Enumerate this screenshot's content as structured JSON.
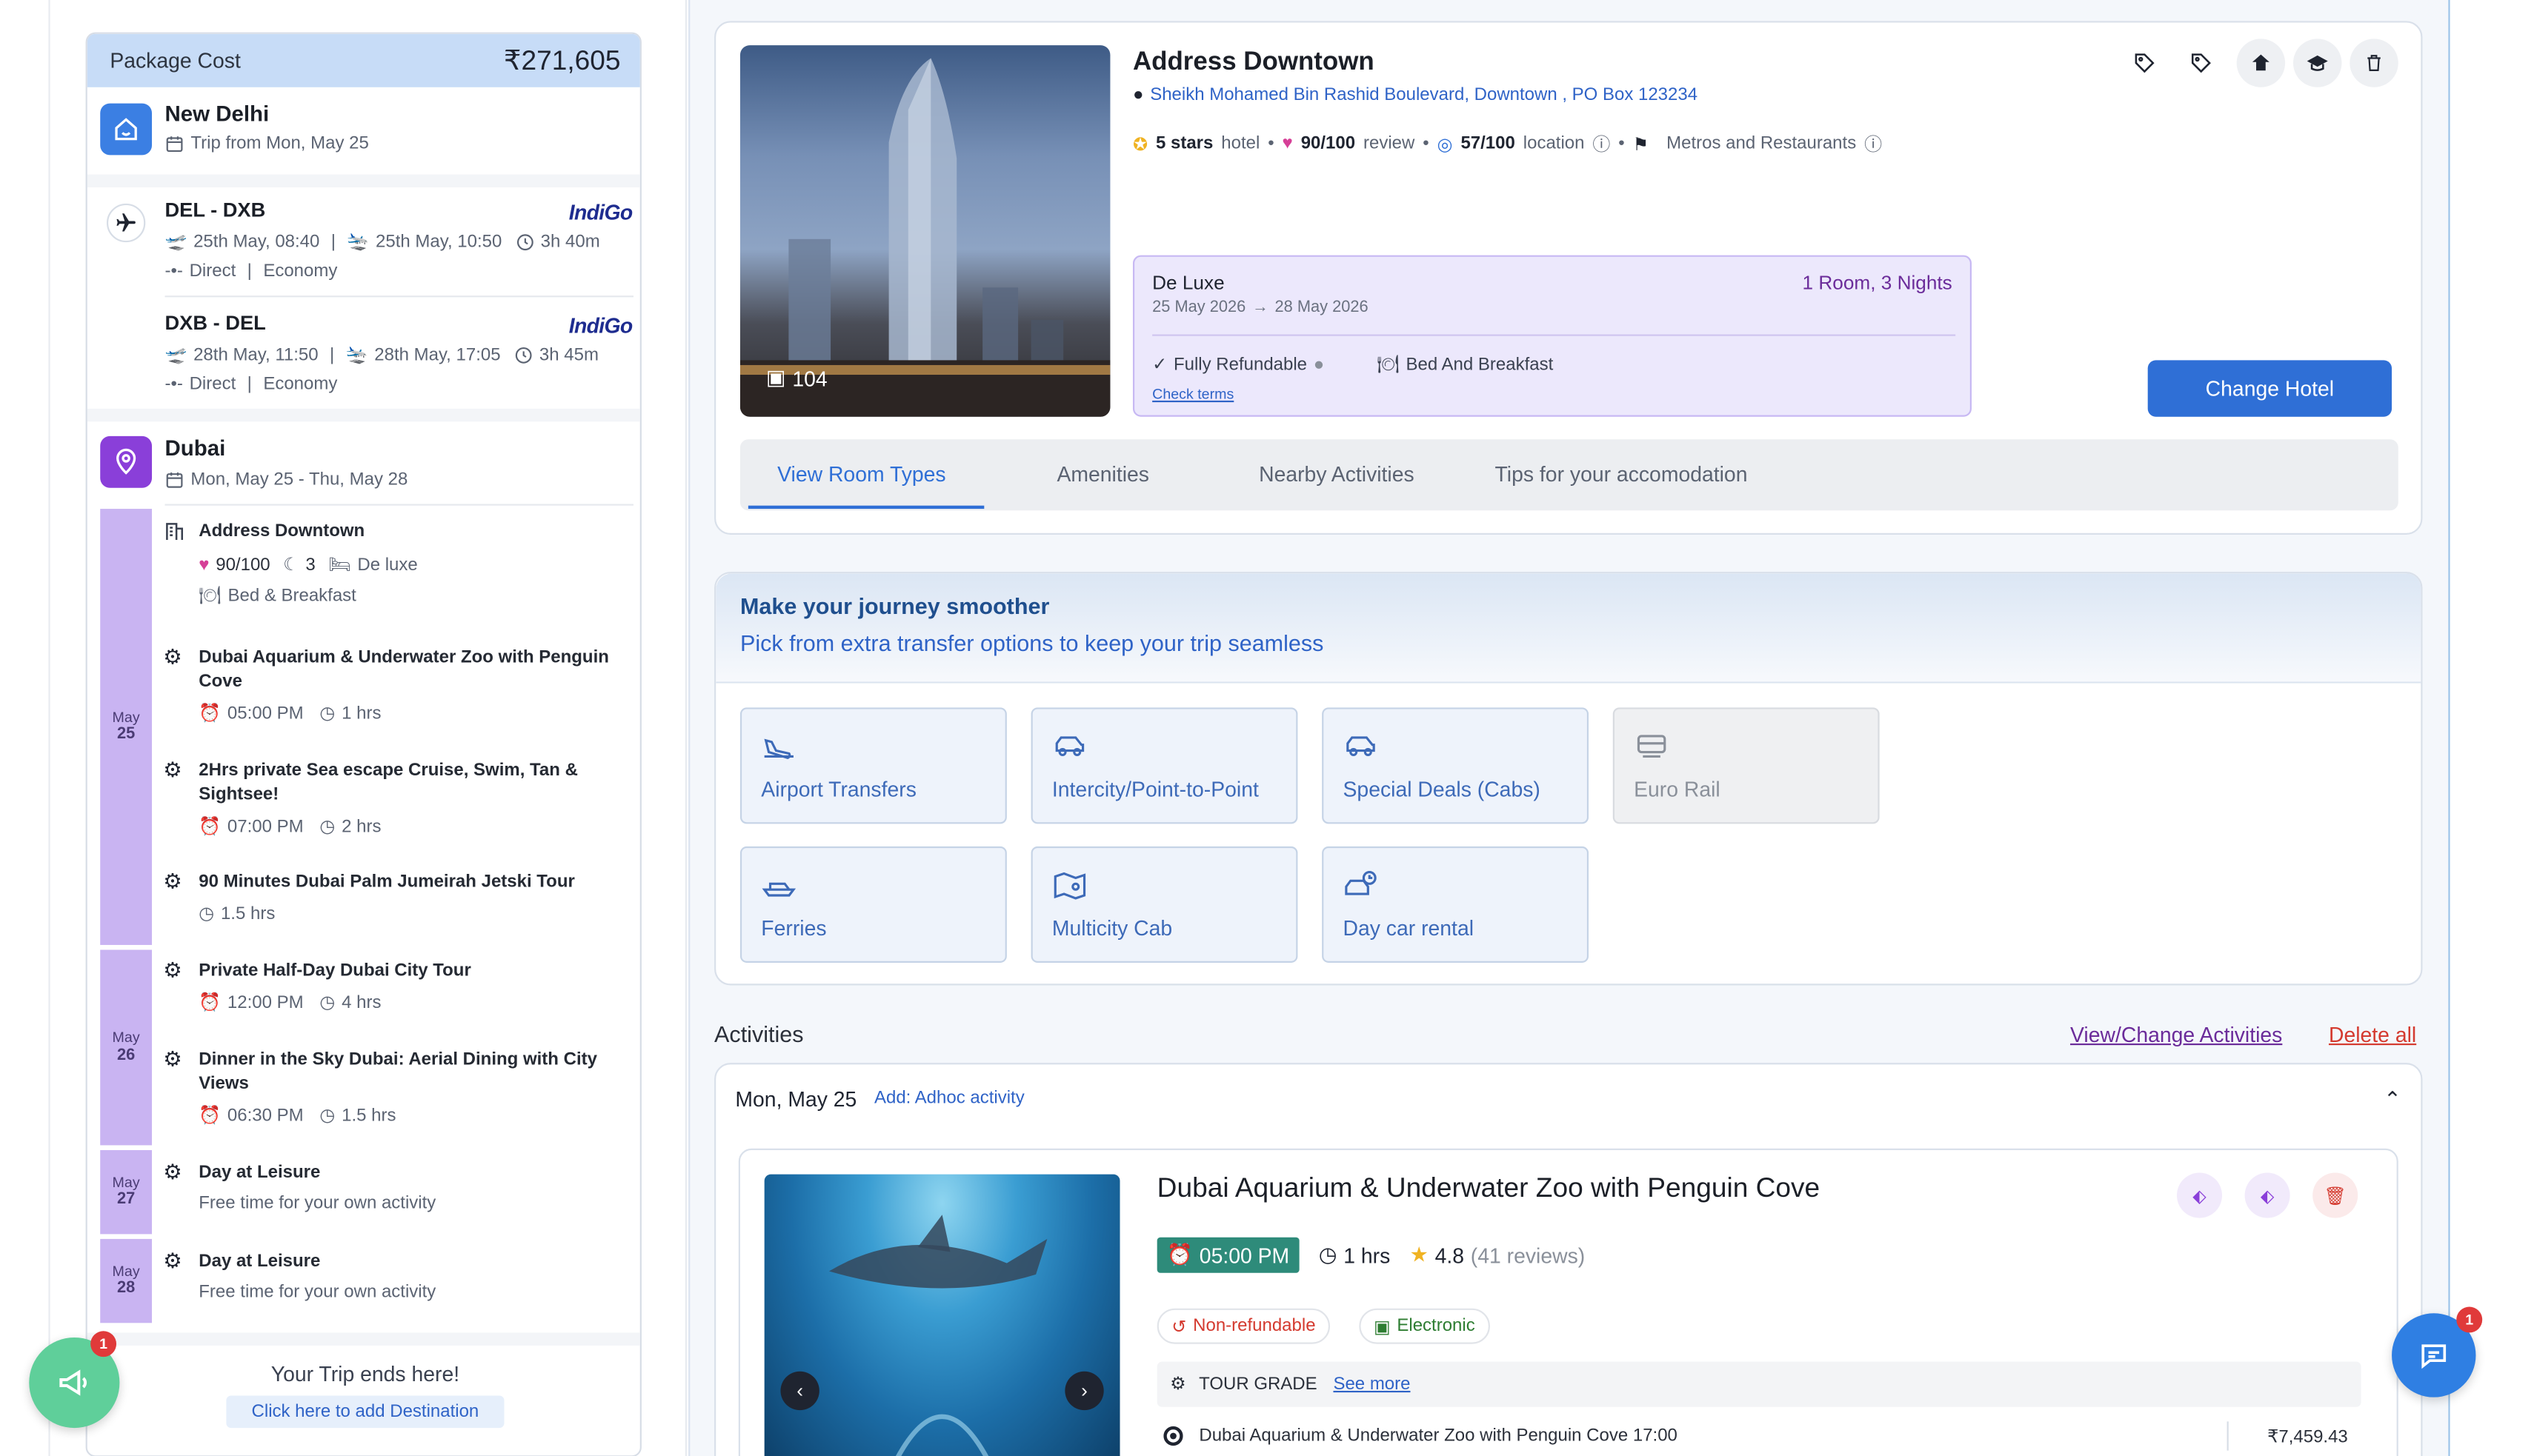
{
  "package": {
    "label": "Package Cost",
    "amount": "₹271,605"
  },
  "origin": {
    "city": "New Delhi",
    "subtitle": "Trip from Mon, May 25"
  },
  "flights": [
    {
      "route": "DEL - DXB",
      "airline": "IndiGo",
      "dep": "25th May, 08:40",
      "arr": "25th May, 10:50",
      "duration": "3h 40m",
      "type": "Direct",
      "cabin": "Economy"
    },
    {
      "route": "DXB - DEL",
      "airline": "IndiGo",
      "dep": "28th May, 11:50",
      "arr": "28th May, 17:05",
      "duration": "3h 45m",
      "type": "Direct",
      "cabin": "Economy"
    }
  ],
  "destination": {
    "city": "Dubai",
    "dates": "Mon, May 25 - Thu, May 28"
  },
  "itinerary": {
    "hotel": {
      "name": "Address Downtown",
      "score": "90/100",
      "nights": "3",
      "room": "De luxe",
      "meal": "Bed & Breakfast"
    },
    "days": [
      {
        "month": "May",
        "day": "25"
      },
      {
        "month": "May",
        "day": "26"
      },
      {
        "month": "May",
        "day": "27"
      },
      {
        "month": "May",
        "day": "28"
      }
    ],
    "activities": [
      {
        "title": "Dubai Aquarium & Underwater Zoo with Penguin Cove",
        "time": "05:00 PM",
        "dur": "1 hrs"
      },
      {
        "title": "2Hrs private Sea escape Cruise, Swim, Tan & Sightsee!",
        "time": "07:00 PM",
        "dur": "2 hrs"
      },
      {
        "title": "90 Minutes Dubai Palm Jumeirah Jetski Tour",
        "time": "",
        "dur": "1.5 hrs"
      },
      {
        "title": "Private Half-Day Dubai City Tour",
        "time": "12:00 PM",
        "dur": "4 hrs"
      },
      {
        "title": "Dinner in the Sky Dubai: Aerial Dining with City Views",
        "time": "06:30 PM",
        "dur": "1.5 hrs"
      },
      {
        "title": "Day at Leisure",
        "time": "",
        "dur": "Free time for your own activity"
      },
      {
        "title": "Day at Leisure",
        "time": "",
        "dur": "Free time for your own activity"
      }
    ]
  },
  "trip_end": {
    "text": "Your Trip ends here!",
    "add": "Click here to add Destination"
  },
  "hotel_card": {
    "name": "Address Downtown",
    "address": "Sheikh Mohamed Bin Rashid Boulevard, Downtown , PO Box 123234",
    "stars": "5 stars",
    "stars_suffix": "hotel",
    "review": "90/100",
    "review_suffix": "review",
    "location": "57/100",
    "location_suffix": "location",
    "nearby": "Metros and Restaurants",
    "photo_count": "104",
    "room_type": "De Luxe",
    "room_nights": "1 Room, 3 Nights",
    "check_in": "25 May 2026",
    "check_out": "28 May 2026",
    "refundable": "Fully Refundable",
    "meal": "Bed And Breakfast",
    "terms": "Check terms",
    "change_btn": "Change Hotel",
    "tabs": [
      "View Room Types",
      "Amenities",
      "Nearby Activities",
      "Tips for your accomodation"
    ]
  },
  "transfers": {
    "title": "Make your journey smoother",
    "subtitle": "Pick from extra transfer options to keep your trip seamless",
    "options": [
      {
        "label": "Airport Transfers",
        "icon": "plane-landing-icon"
      },
      {
        "label": "Intercity/Point-to-Point",
        "icon": "car-icon"
      },
      {
        "label": "Special Deals (Cabs)",
        "icon": "car-icon"
      },
      {
        "label": "Euro Rail",
        "icon": "train-icon"
      },
      {
        "label": "Ferries",
        "icon": "ferry-icon"
      },
      {
        "label": "Multicity Cab",
        "icon": "map-icon"
      },
      {
        "label": "Day car rental",
        "icon": "car-clock-icon"
      }
    ]
  },
  "activities_section": {
    "heading": "Activities",
    "change_link": "View/Change Activities",
    "delete_link": "Delete all",
    "day_label": "Mon, May 25",
    "adhoc": "Add: Adhoc activity",
    "card": {
      "title": "Dubai Aquarium & Underwater Zoo with Penguin Cove",
      "time": "05:00 PM",
      "duration": "1 hrs",
      "rating": "4.8",
      "reviews": "(41 reviews)",
      "refund": "Non-refundable",
      "ticket": "Electronic",
      "grade_label": "TOUR GRADE",
      "see_more": "See more",
      "option": "Dubai Aquarium & Underwater Zoo with Penguin Cove 17:00",
      "price": "₹7,459.43"
    }
  },
  "fab": {
    "left_badge": "1",
    "right_badge": "1"
  },
  "colors": {
    "primary": "#2f6fd6",
    "purple": "#8a3fd9",
    "green": "#5fcf9a",
    "teal": "#2e8b7a"
  }
}
